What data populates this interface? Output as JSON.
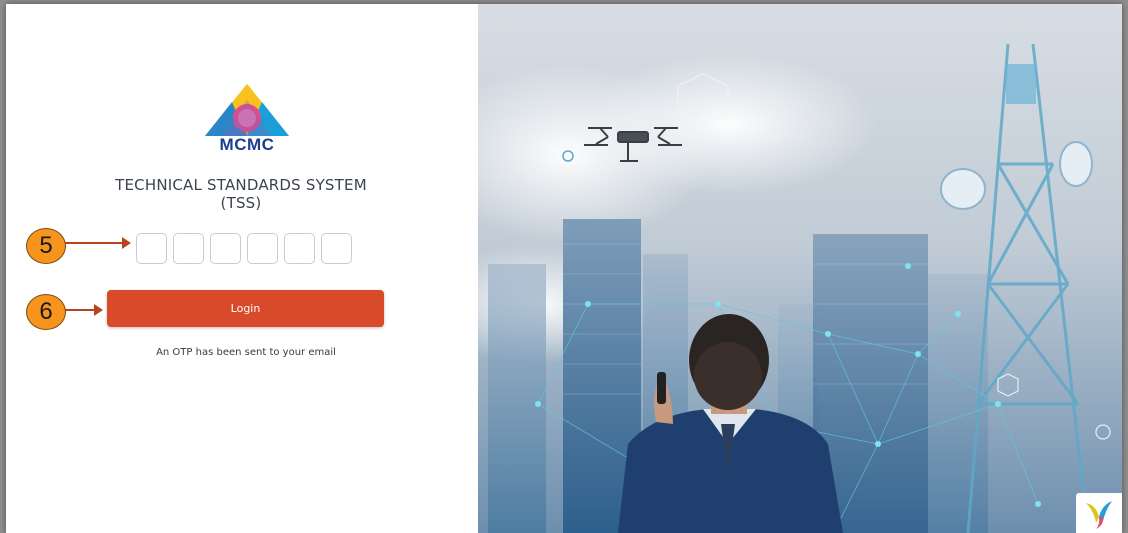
{
  "login": {
    "brand": "MCMC",
    "title_line1": "TECHNICAL STANDARDS SYSTEM",
    "title_line2": "(TSS)",
    "otp_digits": [
      "",
      "",
      "",
      "",
      "",
      ""
    ],
    "login_label": "Login",
    "otp_message": "An OTP has been sent to your email"
  },
  "callouts": {
    "otp_step": "5",
    "login_step": "6"
  },
  "colors": {
    "accent": "#d94a2b",
    "callout": "#f7941d",
    "brand_blue": "#1b3f8f"
  },
  "icons": {
    "logo": "mcmc-logo",
    "corner": "yii-logo-icon"
  }
}
